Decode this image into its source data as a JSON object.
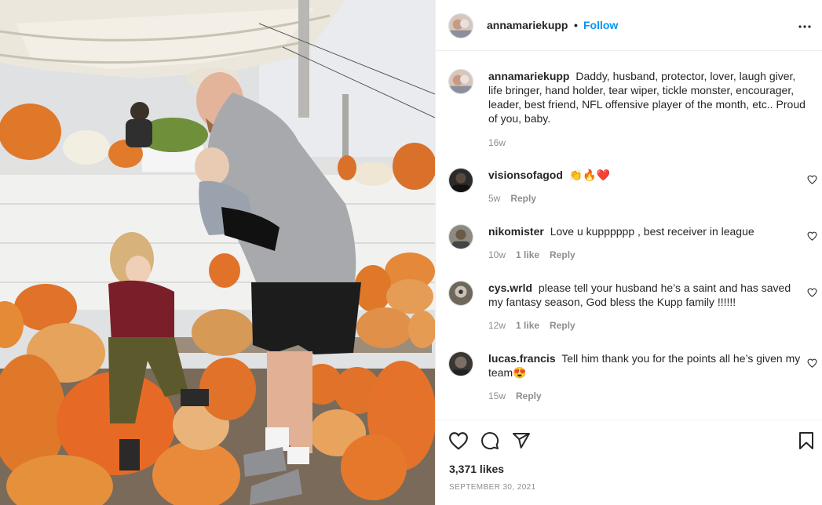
{
  "post": {
    "author": "annamariekupp",
    "separator": "•",
    "follow_label": "Follow",
    "more_icon": "more-horizontal-icon",
    "photo_description_icon": "post-photo"
  },
  "caption": {
    "username": "annamariekupp",
    "text": "Daddy, husband, protector, lover, laugh giver, life bringer, hand holder, tear wiper, tickle monster, encourager, leader, best friend, NFL offensive player of the month, etc.. Proud of you, baby.",
    "time": "16w"
  },
  "comments": [
    {
      "username": "visionsofagod",
      "text": "👏🔥❤️",
      "time": "5w",
      "likes": "",
      "reply": "Reply"
    },
    {
      "username": "nikomister",
      "text": "Love u kupppppp , best receiver in league",
      "time": "10w",
      "likes": "1 like",
      "reply": "Reply"
    },
    {
      "username": "cys.wrld",
      "text": "please tell your husband he’s a saint and has saved my fantasy season, God bless the Kupp family !!!!!!",
      "time": "12w",
      "likes": "1 like",
      "reply": "Reply"
    },
    {
      "username": "lucas.francis",
      "text": "Tell him thank you for the points all he’s given my team😍",
      "time": "15w",
      "likes": "",
      "reply": "Reply"
    }
  ],
  "actions": {
    "like_icon": "heart-icon",
    "comment_icon": "comment-icon",
    "share_icon": "share-icon",
    "save_icon": "bookmark-icon"
  },
  "likes": "3,371 likes",
  "date": "SEPTEMBER 30, 2021",
  "colors": {
    "link": "#0095f6",
    "text": "#262626",
    "secondary": "#8e8e8e",
    "border": "#efefef"
  }
}
